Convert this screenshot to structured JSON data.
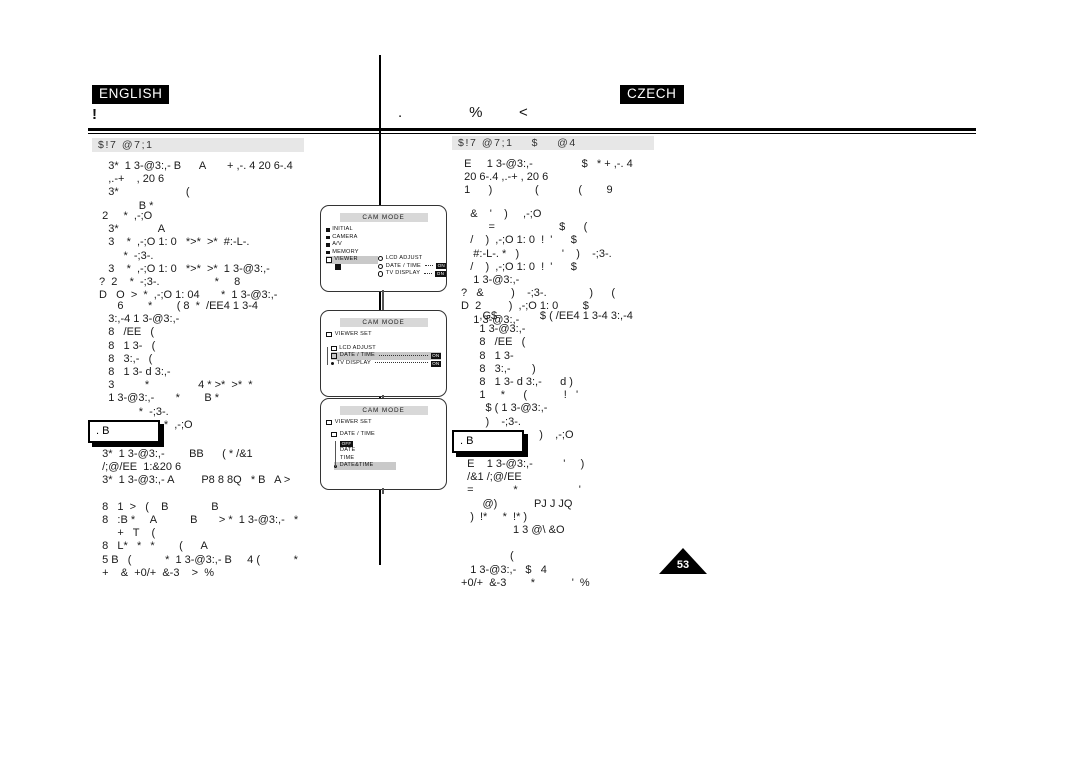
{
  "page": {
    "number": "53",
    "left_language": "ENGLISH",
    "right_language": "CZECH"
  },
  "chapters": {
    "english_title": "!",
    "czech_title": ".      %   <"
  },
  "sections": {
    "english_header": "$!7 @7;1",
    "czech_header": "$!7 @7;1    $    @4"
  },
  "english_column": {
    "intro": "    3*  1 3-@3:,- B      A       + ,-. 4 20 6-.4\n    ,.-+    , 20 6\n    3*                      (\n              B *",
    "step_block": "  2     *  ,-;O\n    3*             A\n    3    *  ,-;O 1: 0   *>*  >*  #:-L-.\n         *  -;3-.\n    3    *  ,-;O 1: 0   *>*  >*  1 3-@3:,-\n ?  2    *  -;3-.                  *     8\n D   O  >  *  ,-;O 1: 04       *  1 3-@3:,-",
    "list_block": "       6        *        ( 8  *  /EE4 1 3-4\n    3:,-4 1 3-@3:,-\n    8   /EE   (\n    8   1 3-   (\n    8   3:,-   (\n    8   1 3- d 3:,-\n    3          *                4 * >*  >*  *\n    1 3-@3:,-       *        B *\n              *  -;3-.\n N  3   C 4      *  ,-;O\n           *  -;3-.",
    "note_label": ". B",
    "note_body": "  3*  1 3-@3:,-        BB      ( * /&1\n  /;@/EE  1:&20 6\n  3*  1 3-@3:,- A         P8 8 8Q   * B   A >\n\n  8   1  >   (    B              B\n  8   :B *     A           B       > *  1 3-@3:,-   *\n       +   T    (\n  8   L*   *   *        (      A\n  5 B   (           *  1 3-@3:,- B     4 (           *\n  +    &  +0/+  &-3    >  %"
  },
  "czech_column": {
    "intro": "  E     1 3-@3:,-                $   * + ,-. 4\n  20 6-.4 ,.-+ , 20 6\n  1      )              (             (        9",
    "step_block": "    &    '    )     ,-;O\n          =                     $      (\n    /    )  ,-;O 1: 0  !  '      $\n     #:-L-. *   )              '    )    -;3-.\n    /    )  ,-;O 1: 0  !  '      $\n     1 3-@3:,-\n ?   &         )    -;3-.              )      (\n D  2         )  ,-;O 1: 0        $\n     1 3-@3:,-",
    "list_block": "       ,G$              $ ( /EE4 1 3-4 3:,-4\n       1 3-@3:,-\n       8   /EE   (\n       8   1 3-\n       8   3:,-       )\n       8   1 3- d 3:,-      d )\n       1     *      (            !   '\n         $ ( 1 3-@3:,-\n         )    -;3-.\n N  ;                    )    ,-;O",
    "note_label": ". B",
    "note_body": "   E    1 3-@3:,-          '     )\n   /&1 /;@/EE\n   =             *                    '\n        @)            PJ J JQ\n    )  !*     *  !* )\n                  1 3 @\\ &O\n\n                 (\n    1 3-@3:,-   $   4\n +0/+  &-3        *            '  %"
  },
  "lcd_panels": [
    {
      "id": "lcd-1",
      "title": "CAM MODE",
      "rows": [
        {
          "label": "INITIAL",
          "icon": "filled-square",
          "highlight": false
        },
        {
          "label": "CAMERA",
          "icon": "filled-square",
          "highlight": false
        },
        {
          "label": "A/V",
          "icon": "filled-square",
          "highlight": false
        },
        {
          "label": "MEMORY",
          "icon": "filled-square",
          "highlight": false
        },
        {
          "label": "VIEWER",
          "icon": "open-square",
          "highlight": true
        }
      ],
      "submenu": [
        {
          "label": "LCD ADJUST",
          "icon": "ring",
          "value": null
        },
        {
          "label": "DATE / TIME",
          "icon": "ring",
          "value": "ON"
        },
        {
          "label": "TV DISPLAY",
          "icon": "ring",
          "value": "ON"
        }
      ]
    },
    {
      "id": "lcd-2",
      "title": "CAM MODE",
      "heading": "VIEWER SET",
      "rows": [
        {
          "label": "LCD ADJUST",
          "icon": "open-square",
          "value": null,
          "highlight": false
        },
        {
          "label": "DATE / TIME",
          "icon": "folder",
          "value": "ON",
          "highlight": true
        },
        {
          "label": "TV DISPLAY",
          "icon": "dot",
          "value": "ON",
          "highlight": false
        }
      ]
    },
    {
      "id": "lcd-3",
      "title": "CAM MODE",
      "heading": "VIEWER SET",
      "subheading": "DATE / TIME",
      "rows": [
        {
          "label": "OFF",
          "icon": "chip",
          "highlight": false
        },
        {
          "label": "DATE",
          "icon": "tick",
          "highlight": false
        },
        {
          "label": "TIME",
          "icon": "tick",
          "highlight": false
        },
        {
          "label": "DATE&TIME",
          "icon": "dot",
          "highlight": true
        }
      ]
    }
  ],
  "colors": {
    "ink": "#000000",
    "bar_grey": "#e7e7e7",
    "lcd_title_grey": "#d8d8d8",
    "lcd_highlight": "#c9c9c9"
  }
}
